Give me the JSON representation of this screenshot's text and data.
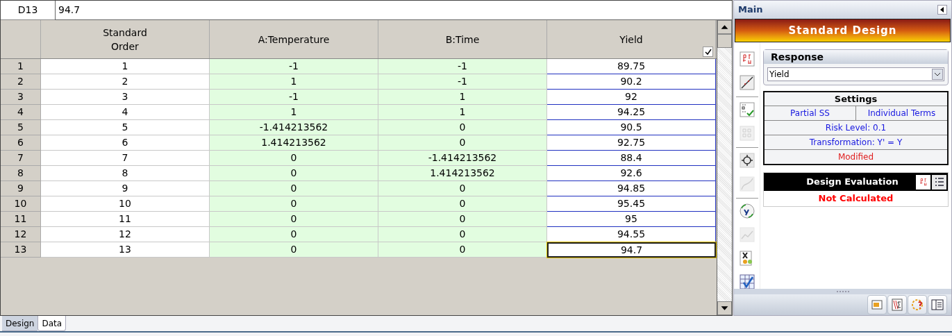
{
  "cell_ref": {
    "name": "D13",
    "value": "94.7"
  },
  "grid": {
    "columns": [
      {
        "label": "Standard Order",
        "kind": "order",
        "active": false
      },
      {
        "label": "A:Temperature",
        "kind": "factor",
        "active": false
      },
      {
        "label": "B:Time",
        "kind": "factor",
        "active": false
      },
      {
        "label": "Yield",
        "kind": "response",
        "checked": true,
        "active": true
      }
    ],
    "rows": [
      {
        "label": "1",
        "cells": [
          "1",
          "-1",
          "-1",
          "89.75"
        ],
        "active": false
      },
      {
        "label": "2",
        "cells": [
          "2",
          "1",
          "-1",
          "90.2"
        ],
        "active": false
      },
      {
        "label": "3",
        "cells": [
          "3",
          "-1",
          "1",
          "92"
        ],
        "active": false
      },
      {
        "label": "4",
        "cells": [
          "4",
          "1",
          "1",
          "94.25"
        ],
        "active": false
      },
      {
        "label": "5",
        "cells": [
          "5",
          "-1.414213562",
          "0",
          "90.5"
        ],
        "active": false
      },
      {
        "label": "6",
        "cells": [
          "6",
          "1.414213562",
          "0",
          "92.75"
        ],
        "active": false
      },
      {
        "label": "7",
        "cells": [
          "7",
          "0",
          "-1.414213562",
          "88.4"
        ],
        "active": false
      },
      {
        "label": "8",
        "cells": [
          "8",
          "0",
          "1.414213562",
          "92.6"
        ],
        "active": false
      },
      {
        "label": "9",
        "cells": [
          "9",
          "0",
          "0",
          "94.85"
        ],
        "active": false
      },
      {
        "label": "10",
        "cells": [
          "10",
          "0",
          "0",
          "95.45"
        ],
        "active": false
      },
      {
        "label": "11",
        "cells": [
          "11",
          "0",
          "0",
          "95"
        ],
        "active": false
      },
      {
        "label": "12",
        "cells": [
          "12",
          "0",
          "0",
          "94.55"
        ],
        "active": false
      },
      {
        "label": "13",
        "cells": [
          "13",
          "0",
          "0",
          "94.7"
        ],
        "active": true
      }
    ]
  },
  "sheet_tabs": [
    {
      "label": "Design",
      "selected": false
    },
    {
      "label": "Data",
      "selected": true
    }
  ],
  "panel": {
    "title": "Main",
    "banner": "Standard Design",
    "toolbar": [
      [
        {
          "kind": "stats",
          "disabled": false
        },
        {
          "kind": "line",
          "disabled": false
        }
      ],
      [
        {
          "kind": "check",
          "disabled": false
        },
        {
          "kind": "grid",
          "disabled": true
        }
      ],
      [
        {
          "kind": "target",
          "disabled": false
        },
        {
          "kind": "curve",
          "disabled": true
        }
      ],
      [
        {
          "kind": "transform",
          "disabled": false
        },
        {
          "kind": "chart",
          "disabled": true
        },
        {
          "kind": "factor",
          "disabled": false
        },
        {
          "kind": "table",
          "disabled": false
        }
      ]
    ],
    "response": {
      "title": "Response",
      "value": "Yield"
    },
    "settings": {
      "title": "Settings",
      "items": [
        [
          "Partial SS",
          "Individual Terms"
        ],
        [
          "Risk Level: 0.1"
        ],
        [
          "Transformation: Y' = Y"
        ]
      ],
      "status": "Modified"
    },
    "evaluation": {
      "title": "Design Evaluation",
      "status": "Not Calculated"
    },
    "bottom_buttons": [
      {
        "kind": "window"
      },
      {
        "kind": "formula"
      },
      {
        "kind": "help"
      },
      {
        "kind": "book"
      }
    ]
  }
}
